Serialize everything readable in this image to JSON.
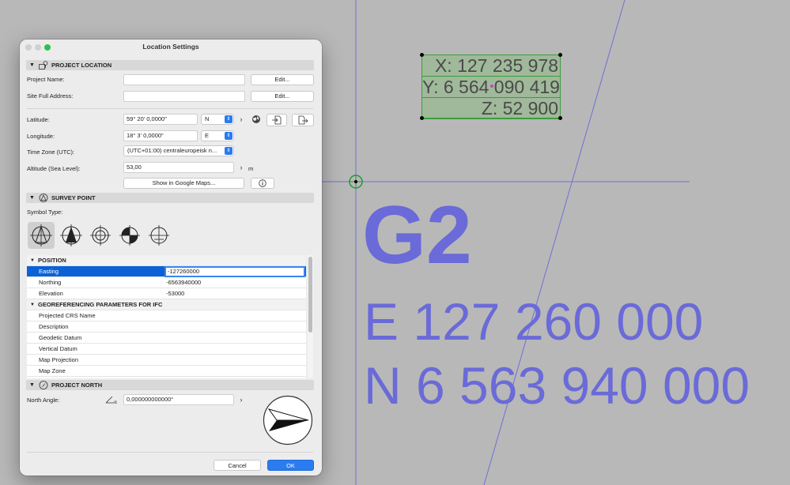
{
  "canvas": {
    "coords": {
      "x": "X: 127 235 978",
      "y": "Y: 6 564 090 419",
      "z": "Z: 52 900"
    },
    "big_label": "G2",
    "easting_label": "E 127 260 000",
    "northing_label": "N 6 563 940 000"
  },
  "dialog": {
    "title": "Location Settings",
    "project_location": {
      "header": "PROJECT LOCATION",
      "project_name_label": "Project Name:",
      "project_name_value": "",
      "site_address_label": "Site Full Address:",
      "site_address_value": "",
      "edit_label": "Edit...",
      "latitude_label": "Latitude:",
      "latitude_value": "59° 20' 0,0000\"",
      "latitude_dir": "N",
      "longitude_label": "Longitude:",
      "longitude_value": "18° 3' 0,0000\"",
      "longitude_dir": "E",
      "timezone_label": "Time Zone (UTC):",
      "timezone_value": "(UTC+01:00) centraleuropeisk n...",
      "altitude_label": "Altitude (Sea Level):",
      "altitude_value": "53,00",
      "altitude_unit": "m",
      "google_maps_label": "Show in Google Maps..."
    },
    "survey_point": {
      "header": "SURVEY POINT",
      "symbol_type_label": "Symbol Type:"
    },
    "table": {
      "position_group": "POSITION",
      "easting_label": "Easting",
      "easting_value": "-127260000",
      "northing_label": "Northing",
      "northing_value": "-6563940000",
      "elevation_label": "Elevation",
      "elevation_value": "-53000",
      "georef_group": "GEOREFERENCING PARAMETERS FOR IFC",
      "georef_rows": [
        "Projected CRS Name",
        "Description",
        "Geodetic Datum",
        "Vertical Datum",
        "Map Projection",
        "Map Zone"
      ]
    },
    "project_north": {
      "header": "PROJECT NORTH",
      "north_angle_label": "North Angle:",
      "north_angle_value": "0,000000000000°"
    },
    "cancel_label": "Cancel",
    "ok_label": "OK"
  },
  "colors": {
    "accent_blue": "#2a7cf0",
    "canvas_text": "#6a6ad8",
    "selection": "#0a62d6"
  }
}
